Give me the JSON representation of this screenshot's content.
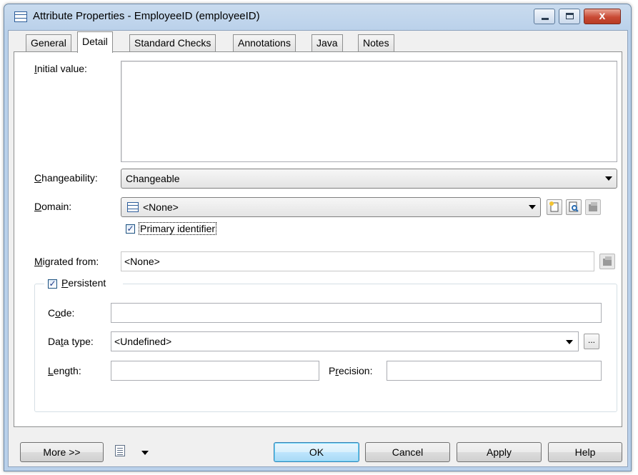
{
  "window": {
    "title": "Attribute Properties - EmployeeID (employeeID)",
    "controls": {
      "minimize_icon": "minimize-icon",
      "maximize_icon": "maximize-icon",
      "close_glyph": "x"
    }
  },
  "tabs": [
    {
      "label": "General",
      "active": false
    },
    {
      "label": "Detail",
      "active": true
    },
    {
      "label": "Standard Checks",
      "active": false
    },
    {
      "label": "Annotations",
      "active": false
    },
    {
      "label": "Java",
      "active": false
    },
    {
      "label": "Notes",
      "active": false
    }
  ],
  "detail": {
    "initial_value": {
      "label_mnemonic": "I",
      "label_rest": "nitial value:",
      "value": ""
    },
    "changeability": {
      "label_mnemonic": "C",
      "label_rest": "hangeability:",
      "value": "Changeable"
    },
    "domain": {
      "label_mnemonic": "D",
      "label_rest": "omain:",
      "value": "<None>"
    },
    "primary_identifier": {
      "label": "Primary identifier",
      "checked": true
    },
    "migrated_from": {
      "label_mnemonic": "M",
      "label_rest": "igrated from:",
      "value": "<None>"
    },
    "persistent": {
      "label_mnemonic": "P",
      "label_rest": "ersistent",
      "checked": true,
      "code": {
        "label_pre": "C",
        "label_mnemonic": "o",
        "label_rest": "de:",
        "value": ""
      },
      "data_type": {
        "label_pre": "Da",
        "label_mnemonic": "t",
        "label_rest": "a type:",
        "value": "<Undefined>",
        "browse": "..."
      },
      "length": {
        "label_mnemonic": "L",
        "label_rest": "ength:",
        "value": ""
      },
      "precision": {
        "label_pre": "P",
        "label_mnemonic": "r",
        "label_rest": "ecision:",
        "value": ""
      }
    }
  },
  "footer": {
    "more": "More >>",
    "ok": "OK",
    "cancel": "Cancel",
    "apply": "Apply",
    "help": "Help"
  },
  "colors": {
    "title_bar": "#b9d0ea",
    "dialog_bg": "#f0f0f0",
    "close_button": "#c94a34",
    "default_button": "#bee6fd",
    "checkbox_mark": "#1f3c88"
  }
}
